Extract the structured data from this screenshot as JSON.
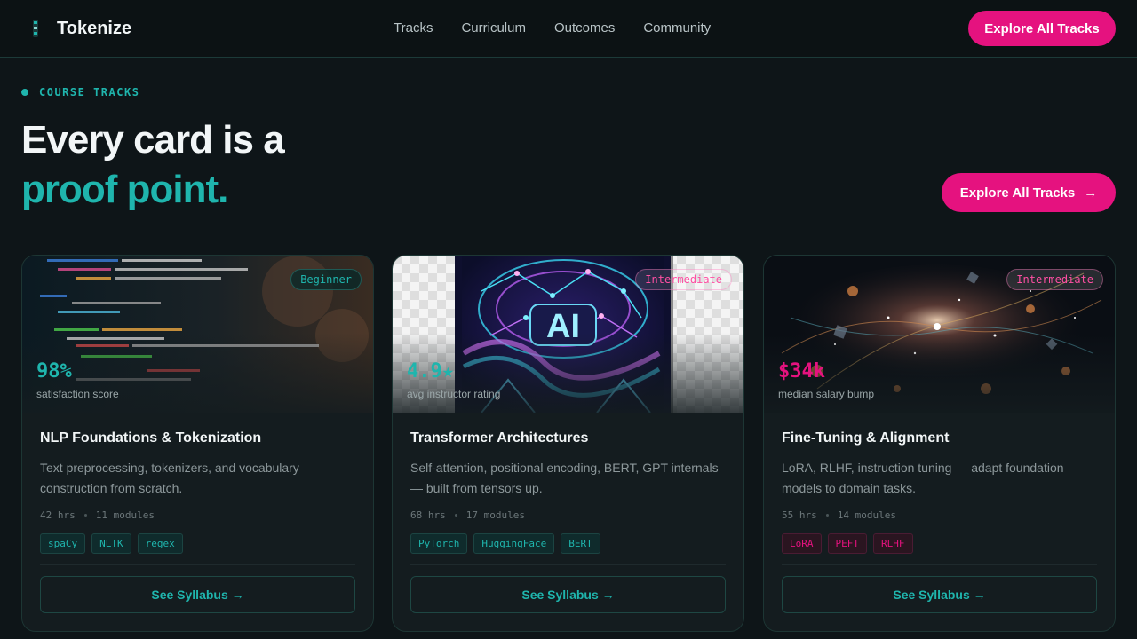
{
  "brand": {
    "name": "Tokenize"
  },
  "nav": {
    "links": [
      "Tracks",
      "Curriculum",
      "Outcomes",
      "Community"
    ],
    "cta_label": "Explore All Tracks"
  },
  "hero": {
    "eyebrow": "COURSE TRACKS",
    "headline_line1": "Every card is a",
    "headline_line2": "proof point.",
    "cta_label": "Explore All Tracks",
    "cta_arrow": "→"
  },
  "cards": [
    {
      "level": "Beginner",
      "stat": "98%",
      "stat_label": "satisfaction score",
      "title": "NLP Foundations & Tokenization",
      "description": "Text preprocessing, tokenizers, and vocabulary construction from scratch.",
      "hours": "42 hrs",
      "modules": "11 modules",
      "tags": [
        "spaCy",
        "NLTK",
        "regex"
      ],
      "button_label": "See Syllabus →"
    },
    {
      "level": "Intermediate",
      "stat": "4.9★",
      "stat_label": "avg instructor rating",
      "title": "Transformer Architectures",
      "description": "Self-attention, positional encoding, BERT, GPT internals — built from tensors up.",
      "hours": "68 hrs",
      "modules": "17 modules",
      "tags": [
        "PyTorch",
        "HuggingFace",
        "BERT"
      ],
      "media_text": "AI",
      "button_label": "See Syllabus →"
    },
    {
      "level": "Intermediate",
      "stat": "$34k",
      "stat_label": "median salary bump",
      "title": "Fine-Tuning & Alignment",
      "description": "LoRA, RLHF, instruction tuning — adapt foundation models to domain tasks.",
      "hours": "55 hrs",
      "modules": "14 modules",
      "tags": [
        "LoRA",
        "PEFT",
        "RLHF"
      ],
      "button_label": "See Syllabus →"
    }
  ],
  "colors": {
    "accent_teal": "#1fb5ad",
    "accent_pink": "#e5127f",
    "background": "#0e1518"
  }
}
